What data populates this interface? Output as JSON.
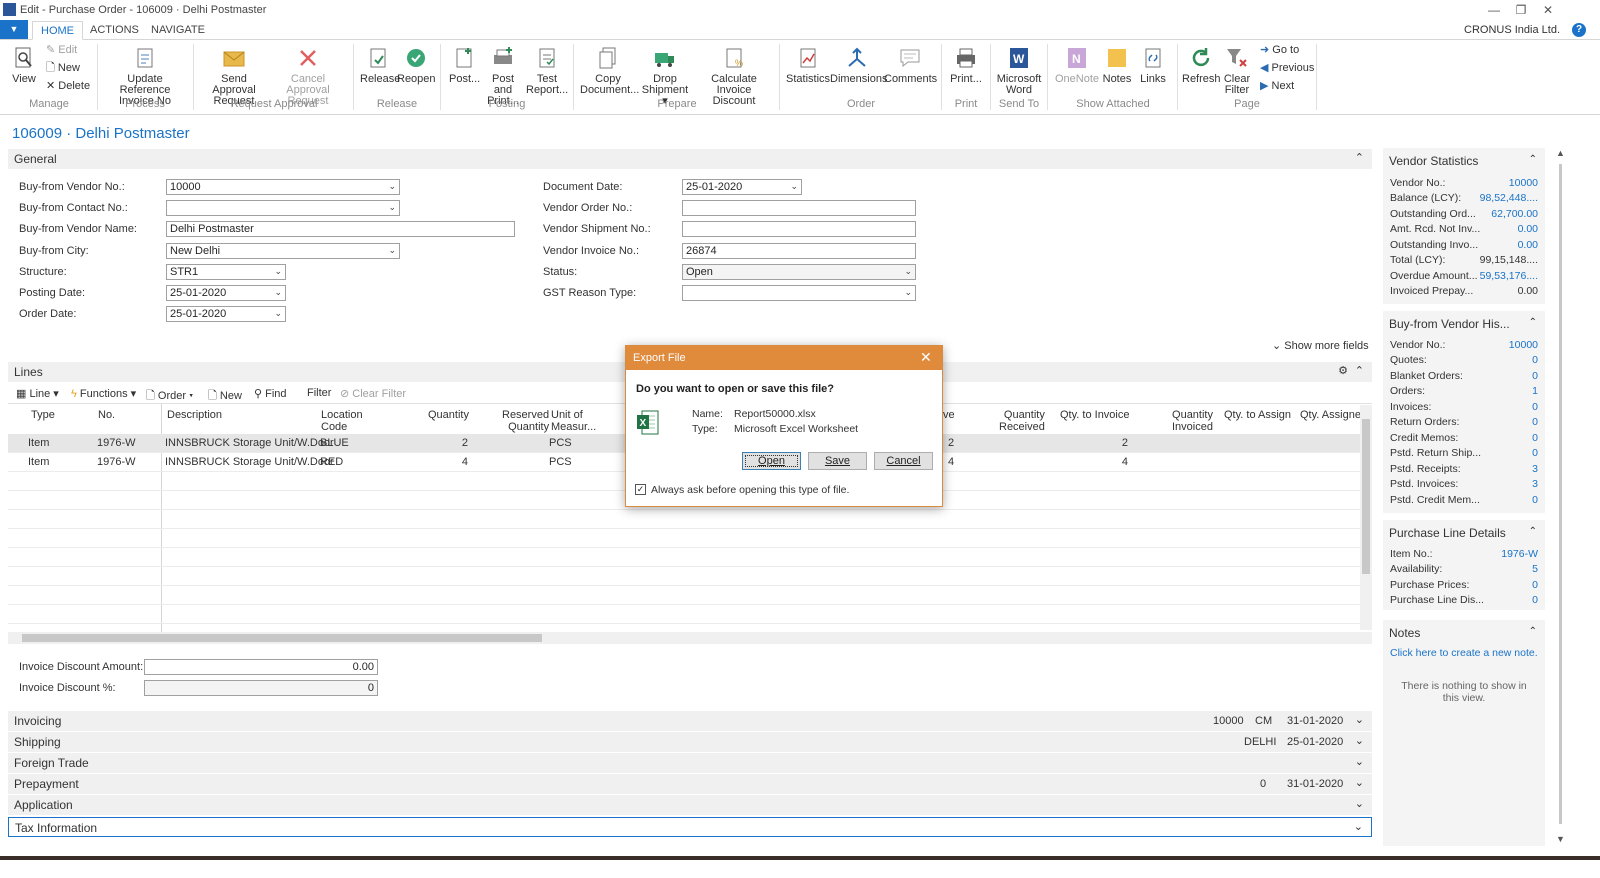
{
  "window": {
    "title": "Edit - Purchase Order - 106009 · Delhi Postmaster"
  },
  "tabs": [
    {
      "label": "HOME"
    },
    {
      "label": "ACTIONS"
    },
    {
      "label": "NAVIGATE"
    }
  ],
  "company": "CRONUS India Ltd.",
  "ribbon": {
    "manage": {
      "view": "View",
      "edit": "Edit",
      "new": "New",
      "delete": "Delete",
      "group": "Manage"
    },
    "process": {
      "update_ref_1": "Update Reference",
      "update_ref_2": "Invoice No",
      "group": "Process"
    },
    "approval": {
      "send_1": "Send Approval",
      "send_2": "Request",
      "cancel_1": "Cancel Approval",
      "cancel_2": "Request",
      "group": "Request Approval"
    },
    "release": {
      "release": "Release",
      "reopen": "Reopen",
      "group": "Release"
    },
    "posting": {
      "post": "Post...",
      "post_print_1": "Post and",
      "post_print_2": "Print...",
      "test_1": "Test",
      "test_2": "Report...",
      "group": "Posting"
    },
    "prepare": {
      "copy_1": "Copy",
      "copy_2": "Document...",
      "drop_1": "Drop",
      "drop_2": "Shipment ▾",
      "calc_1": "Calculate Invoice",
      "calc_2": "Discount",
      "group": "Prepare"
    },
    "order": {
      "statistics": "Statistics",
      "dimensions": "Dimensions",
      "comments": "Comments",
      "group": "Order"
    },
    "print": {
      "print": "Print...",
      "group": "Print"
    },
    "sendto": {
      "word_1": "Microsoft",
      "word_2": "Word",
      "group": "Send To"
    },
    "attached": {
      "onenote": "OneNote",
      "notes": "Notes",
      "links": "Links",
      "group": "Show Attached"
    },
    "page": {
      "refresh": "Refresh",
      "clear_1": "Clear",
      "clear_2": "Filter",
      "goto": "Go to",
      "previous": "Previous",
      "next": "Next",
      "group": "Page"
    }
  },
  "page_title": "106009 · Delhi Postmaster",
  "general": {
    "header": "General",
    "buy_from_vendor_no": {
      "label": "Buy-from Vendor No.:",
      "value": "10000"
    },
    "buy_from_contact_no": {
      "label": "Buy-from Contact No.:",
      "value": ""
    },
    "buy_from_vendor_name": {
      "label": "Buy-from Vendor Name:",
      "value": "Delhi Postmaster"
    },
    "buy_from_city": {
      "label": "Buy-from City:",
      "value": "New Delhi"
    },
    "structure": {
      "label": "Structure:",
      "value": "STR1"
    },
    "posting_date": {
      "label": "Posting Date:",
      "value": "25-01-2020"
    },
    "order_date": {
      "label": "Order Date:",
      "value": "25-01-2020"
    },
    "document_date": {
      "label": "Document Date:",
      "value": "25-01-2020"
    },
    "vendor_order_no": {
      "label": "Vendor Order No.:",
      "value": ""
    },
    "vendor_shipment_no": {
      "label": "Vendor Shipment No.:",
      "value": ""
    },
    "vendor_invoice_no": {
      "label": "Vendor Invoice No.:",
      "value": "26874"
    },
    "status": {
      "label": "Status:",
      "value": "Open"
    },
    "gst_reason_type": {
      "label": "GST Reason Type:",
      "value": ""
    },
    "show_more": "Show more fields"
  },
  "lines": {
    "header": "Lines",
    "toolbar": {
      "line": "Line",
      "functions": "Functions",
      "order": "Order",
      "new": "New",
      "find": "Find",
      "filter": "Filter",
      "clear_filter": "Clear Filter"
    },
    "columns": {
      "type": "Type",
      "no": "No.",
      "description": "Description",
      "location_1": "Location",
      "location_2": "Code",
      "quantity": "Quantity",
      "reserved_1": "Reserved",
      "reserved_2": "Quantity",
      "uom_1": "Unit of",
      "uom_2": "Measur...",
      "receive": "ve",
      "qty_received_1": "Quantity",
      "qty_received_2": "Received",
      "qty_to_invoice": "Qty. to Invoice",
      "qty_invoiced_1": "Quantity",
      "qty_invoiced_2": "Invoiced",
      "qty_to_assign": "Qty. to Assign",
      "qty_assigned": "Qty. Assigned"
    },
    "rows": [
      {
        "type": "Item",
        "no": "1976-W",
        "description": "INNSBRUCK Storage Unit/W.Door",
        "location": "BLUE",
        "quantity": "2",
        "uom": "PCS",
        "receive": "2",
        "qty_to_invoice": "2"
      },
      {
        "type": "Item",
        "no": "1976-W",
        "description": "INNSBRUCK Storage Unit/W.Door",
        "location": "RED",
        "quantity": "4",
        "uom": "PCS",
        "receive": "4",
        "qty_to_invoice": "4"
      }
    ]
  },
  "invoice_discount": {
    "amount": {
      "label": "Invoice Discount Amount:",
      "value": "0.00"
    },
    "percent": {
      "label": "Invoice Discount %:",
      "value": "0"
    }
  },
  "fasttabs": {
    "invoicing": {
      "label": "Invoicing",
      "s1": "10000",
      "s2": "CM",
      "s3": "31-01-2020"
    },
    "shipping": {
      "label": "Shipping",
      "s1": "DELHI",
      "s2": "25-01-2020"
    },
    "foreign_trade": {
      "label": "Foreign Trade"
    },
    "prepayment": {
      "label": "Prepayment",
      "s1": "0",
      "s2": "31-01-2020"
    },
    "application": {
      "label": "Application"
    },
    "tax_information": {
      "label": "Tax Information"
    }
  },
  "factboxes": {
    "vendor_statistics": {
      "title": "Vendor Statistics",
      "rows": [
        {
          "label": "Vendor No.:",
          "value": "10000"
        },
        {
          "label": "Balance (LCY):",
          "value": "98,52,448...."
        },
        {
          "label": "Outstanding Ord...",
          "value": "62,700.00"
        },
        {
          "label": "Amt. Rcd. Not Inv...",
          "value": "0.00"
        },
        {
          "label": "Outstanding Invo...",
          "value": "0.00"
        },
        {
          "label": "Total (LCY):",
          "value": "99,15,148...."
        },
        {
          "label": "Overdue Amount...",
          "value": "59,53,176...."
        },
        {
          "label": "Invoiced Prepay...",
          "value": "0.00"
        }
      ]
    },
    "vendor_history": {
      "title": "Buy-from Vendor His...",
      "rows": [
        {
          "label": "Vendor No.:",
          "value": "10000"
        },
        {
          "label": "Quotes:",
          "value": "0"
        },
        {
          "label": "Blanket Orders:",
          "value": "0"
        },
        {
          "label": "Orders:",
          "value": "1"
        },
        {
          "label": "Invoices:",
          "value": "0"
        },
        {
          "label": "Return Orders:",
          "value": "0"
        },
        {
          "label": "Credit Memos:",
          "value": "0"
        },
        {
          "label": "Pstd. Return Ship...",
          "value": "0"
        },
        {
          "label": "Pstd. Receipts:",
          "value": "3"
        },
        {
          "label": "Pstd. Invoices:",
          "value": "3"
        },
        {
          "label": "Pstd. Credit Mem...",
          "value": "0"
        }
      ]
    },
    "purchase_line_details": {
      "title": "Purchase Line Details",
      "rows": [
        {
          "label": "Item No.:",
          "value": "1976-W"
        },
        {
          "label": "Availability:",
          "value": "5"
        },
        {
          "label": "Purchase Prices:",
          "value": "0"
        },
        {
          "label": "Purchase Line Dis...",
          "value": "0"
        }
      ]
    },
    "notes": {
      "title": "Notes",
      "link": "Click here to create a new note.",
      "empty": "There is nothing to show in this view."
    }
  },
  "dialog": {
    "title": "Export File",
    "question": "Do you want to open or save this file?",
    "name_label": "Name:",
    "name_value": "Report50000.xlsx",
    "type_label": "Type:",
    "type_value": "Microsoft Excel Worksheet",
    "open": "Open",
    "save": "Save",
    "cancel": "Cancel",
    "checkbox_label": "Always ask before opening this type of file.",
    "checkbox_checked": true
  },
  "colors": {
    "accent": "#1a73c8",
    "dialog_header": "#e08a3c",
    "fasttab_bg": "#f0f0f0"
  }
}
